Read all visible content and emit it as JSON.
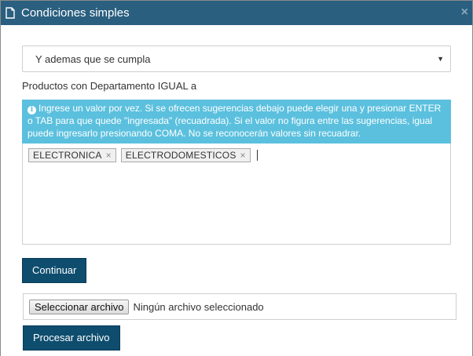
{
  "modal": {
    "title": "Condiciones simples",
    "close_glyph": "×"
  },
  "condition_select": {
    "selected": "Y ademas que se cumpla"
  },
  "field_label": "Productos con Departamento IGUAL a",
  "info_text": "Ingrese un valor por vez. Si se ofrecen sugerencias debajo puede elegir una y presionar ENTER o TAB para que quede \"ingresada\" (recuadrada). Si el valor no figura entre las sugerencias, igual puede ingresarlo presionando COMA. No se reconocerán valores sin recuadrar.",
  "tags": [
    "ELECTRONICA",
    "ELECTRODOMESTICOS"
  ],
  "tag_remove_glyph": "×",
  "buttons": {
    "continue": "Continuar",
    "process_file": "Procesar archivo"
  },
  "file_input": {
    "button_label": "Seleccionar archivo",
    "status": "Ningún archivo seleccionado"
  },
  "icons": {
    "title": "document-icon",
    "close": "close-icon",
    "info": "info-icon",
    "caret": "caret-down-icon"
  },
  "colors": {
    "header": "#2a5f80",
    "info_bg": "#5bc0de",
    "button": "#0e4d6e"
  }
}
